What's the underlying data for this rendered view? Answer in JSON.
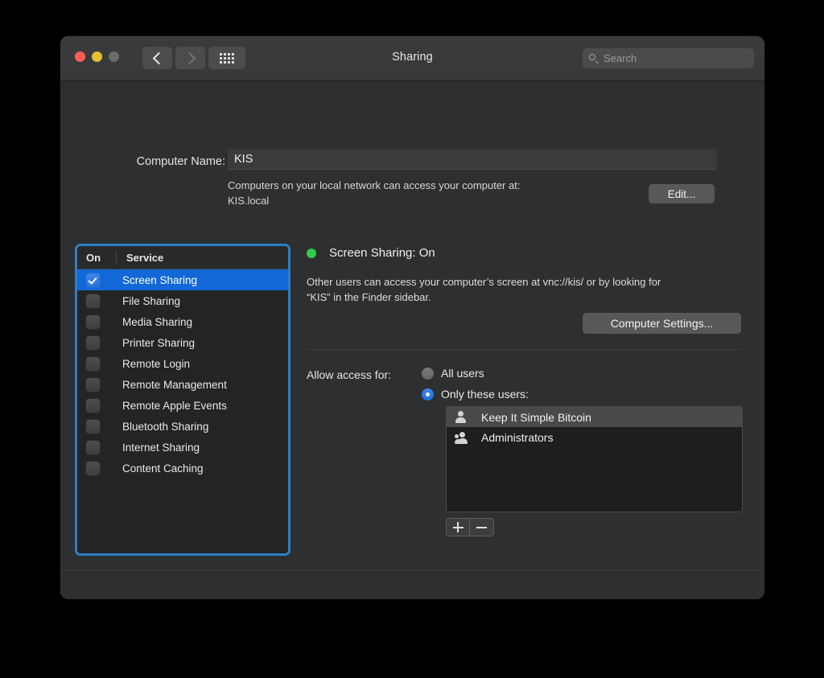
{
  "window": {
    "title": "Sharing",
    "traffic_lights": {
      "close": "close-button",
      "minimize": "minimize-button",
      "zoom": "zoom-button"
    },
    "search": {
      "placeholder": "Search",
      "value": ""
    }
  },
  "computer_name": {
    "label": "Computer Name:",
    "value": "KIS",
    "description": "Computers on your local network can access your computer at:\nKIS.local",
    "description_line1": "Computers on your local network can access your computer at:",
    "description_line2": "KIS.local",
    "edit_button": "Edit..."
  },
  "service_list": {
    "headers": {
      "on": "On",
      "service": "Service"
    },
    "rows": [
      {
        "label": "Screen Sharing",
        "checked": true,
        "selected": true
      },
      {
        "label": "File Sharing",
        "checked": false,
        "selected": false
      },
      {
        "label": "Media Sharing",
        "checked": false,
        "selected": false
      },
      {
        "label": "Printer Sharing",
        "checked": false,
        "selected": false
      },
      {
        "label": "Remote Login",
        "checked": false,
        "selected": false
      },
      {
        "label": "Remote Management",
        "checked": false,
        "selected": false
      },
      {
        "label": "Remote Apple Events",
        "checked": false,
        "selected": false
      },
      {
        "label": "Bluetooth Sharing",
        "checked": false,
        "selected": false
      },
      {
        "label": "Internet Sharing",
        "checked": false,
        "selected": false
      },
      {
        "label": "Content Caching",
        "checked": false,
        "selected": false
      }
    ]
  },
  "detail": {
    "status_title": "Screen Sharing: On",
    "status_color": "#30cc4a",
    "description_line1": "Other users can access your computer’s screen at vnc://kis/ or by looking for",
    "description_line2": "“KIS” in the Finder sidebar.",
    "computer_settings_button": "Computer Settings...",
    "allow_access_label": "Allow access for:",
    "radios": [
      {
        "label": "All users",
        "selected": false
      },
      {
        "label": "Only these users:",
        "selected": true
      }
    ],
    "users": [
      {
        "name": "Keep It Simple Bitcoin",
        "icon": "single-user-icon",
        "highlighted": true
      },
      {
        "name": "Administrators",
        "icon": "group-user-icon",
        "highlighted": false
      }
    ],
    "add_button": "+",
    "remove_button": "−"
  },
  "footer": {
    "help_button": "?"
  },
  "colors": {
    "accent_blue": "#1268d6",
    "focus_ring": "#2d7fc4",
    "window_bg": "#2e2f31",
    "titlebar_bg": "#37383a",
    "status_green": "#30cc4a"
  }
}
